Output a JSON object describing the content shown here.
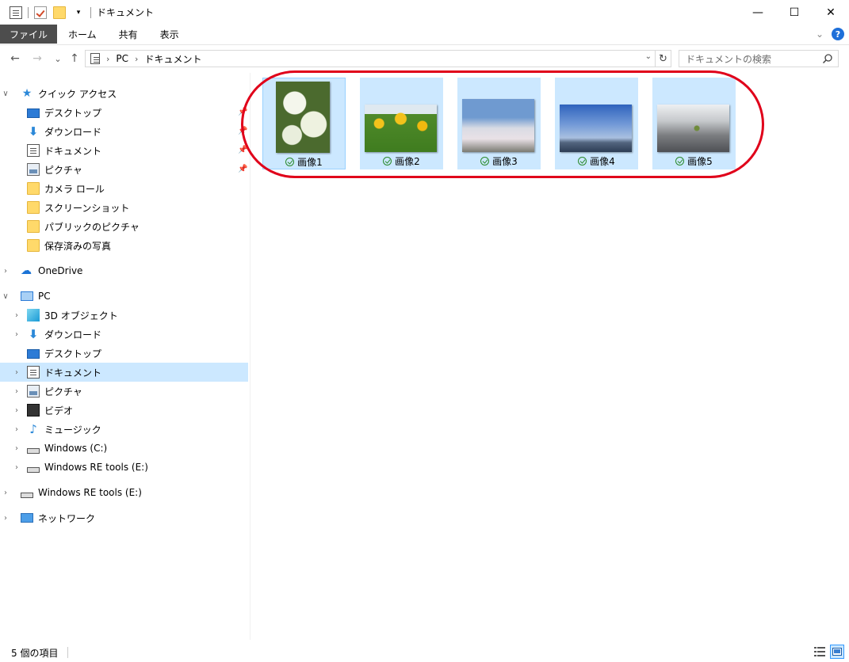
{
  "window": {
    "title": "ドキュメント",
    "minimize": "—",
    "maximize": "☐",
    "close": "✕"
  },
  "ribbon": {
    "tabs": [
      "ファイル",
      "ホーム",
      "共有",
      "表示"
    ],
    "expand": "⌄",
    "help": "?"
  },
  "address": {
    "back": "←",
    "forward": "→",
    "recent": "⌄",
    "up": "↑",
    "crumbs": [
      "PC",
      "ドキュメント"
    ],
    "refresh": "↻",
    "search_placeholder": "ドキュメントの検索"
  },
  "nav": {
    "quick_access": "クイック アクセス",
    "quick_items": [
      "デスクトップ",
      "ダウンロード",
      "ドキュメント",
      "ピクチャ",
      "カメラ ロール",
      "スクリーンショット",
      "パブリックのピクチャ",
      "保存済みの写真"
    ],
    "onedrive": "OneDrive",
    "pc": "PC",
    "pc_items": [
      "3D オブジェクト",
      "ダウンロード",
      "デスクトップ",
      "ドキュメント",
      "ピクチャ",
      "ビデオ",
      "ミュージック",
      "Windows (C:)",
      "Windows RE tools (E:)"
    ],
    "drive_e": "Windows RE tools (E:)",
    "network": "ネットワーク"
  },
  "files": [
    {
      "name": "画像1",
      "colors": [
        "#e9eedc",
        "#4b6a2e"
      ]
    },
    {
      "name": "画像2",
      "colors": [
        "#f3c21b",
        "#3f7c1f"
      ]
    },
    {
      "name": "画像3",
      "colors": [
        "#b8c7dc",
        "#e9e1e6"
      ]
    },
    {
      "name": "画像4",
      "colors": [
        "#3f73c9",
        "#a9c0e0"
      ]
    },
    {
      "name": "画像5",
      "colors": [
        "#c5c8cb",
        "#4e5055"
      ]
    }
  ],
  "status": {
    "count": "5 個の項目"
  },
  "colors": {
    "selection": "#cce8ff",
    "highlight_oval": "#e0001a",
    "file_tab": "#4d4d4d"
  }
}
